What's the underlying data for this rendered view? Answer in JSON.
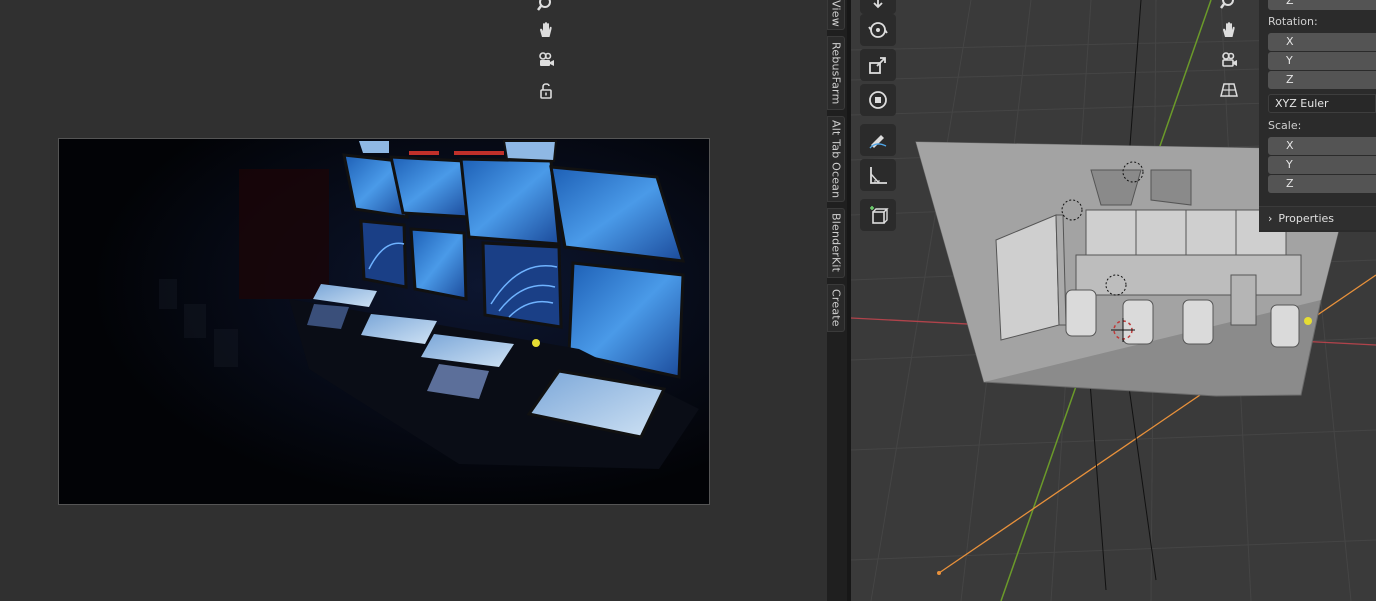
{
  "side_tabs": [
    {
      "label": "View"
    },
    {
      "label": "RebusFarm"
    },
    {
      "label": "Alt Tab Ocean"
    },
    {
      "label": "BlenderKit"
    },
    {
      "label": "Create"
    }
  ],
  "n_panel": {
    "rotation_label": "Rotation:",
    "rotation_axes": [
      "X",
      "Y",
      "Z"
    ],
    "rotation_mode": "XYZ Euler",
    "scale_label": "Scale:",
    "scale_axes": [
      "X",
      "Y",
      "Z"
    ],
    "top_axis": "Z",
    "properties_label": "Properties"
  },
  "colors": {
    "accent_orange": "#e8913b",
    "axis_green": "#6b9a2a",
    "axis_red": "#b0434b",
    "light_yellow": "#e6dd33",
    "screen_blue": "#3a86d8"
  }
}
